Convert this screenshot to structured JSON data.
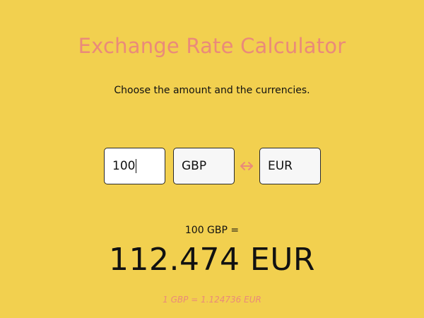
{
  "header": {
    "title": "Exchange Rate Calculator",
    "subtitle": "Choose the amount and the currencies."
  },
  "form": {
    "amount_value": "100",
    "from_currency": "GBP",
    "to_currency": "EUR",
    "swap_icon": "left-right-arrow-icon"
  },
  "result": {
    "prefix": "100 GBP =",
    "value": "112.474 EUR",
    "rate_note": "1 GBP = 1.124736 EUR"
  },
  "colors": {
    "background": "#f2d04f",
    "accent": "#ea8a7a",
    "text": "#111111"
  }
}
